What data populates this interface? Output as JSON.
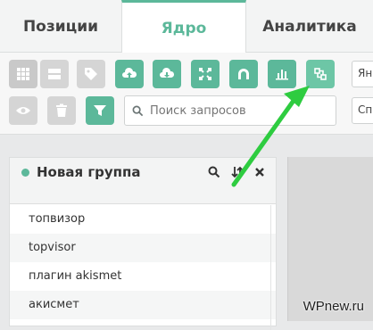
{
  "tabs": [
    {
      "label": "Позиции"
    },
    {
      "label": "Ядро"
    },
    {
      "label": "Аналитика"
    }
  ],
  "toolbar": {
    "search_placeholder": "Поиск запросов",
    "region_select_value": "Ян",
    "sort_select_value": "Сп"
  },
  "group": {
    "title": "Новая группа",
    "items": [
      "топвизор",
      "topvisor",
      "плагин akismet",
      "акисмет"
    ]
  },
  "watermark": "WPnew.ru",
  "colors": {
    "accent": "#5cb89a",
    "arrow": "#2ecc40"
  }
}
